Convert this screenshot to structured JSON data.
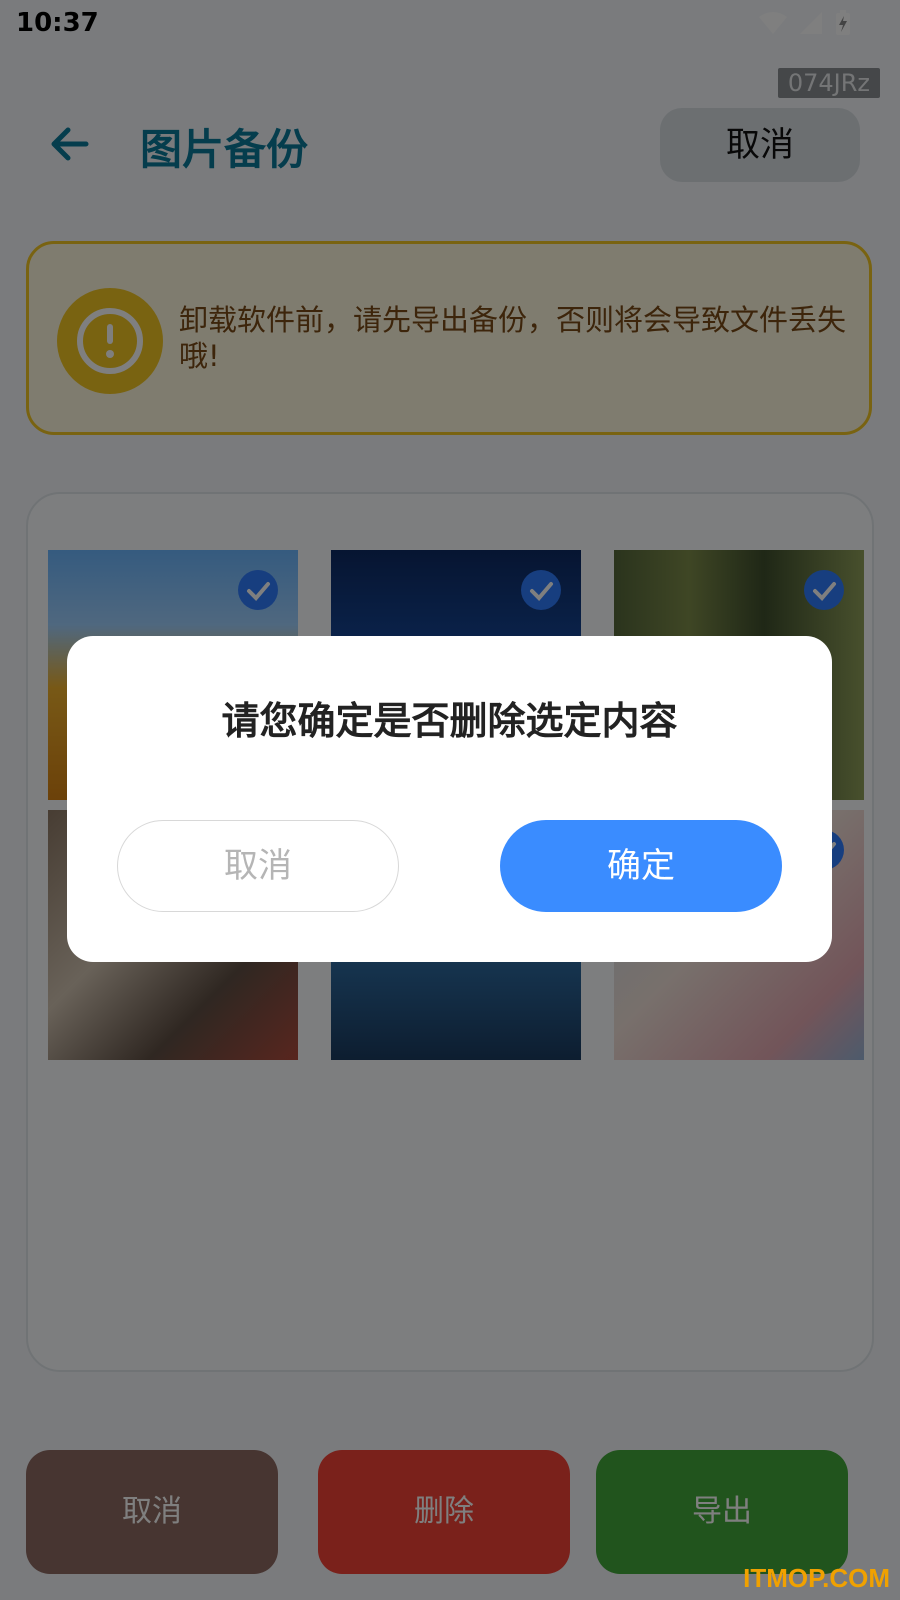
{
  "status_bar": {
    "time": "10:37",
    "icons": [
      "wifi-icon",
      "signal-icon",
      "battery-charging-icon"
    ]
  },
  "tag": "074JRz",
  "header": {
    "title": "图片备份",
    "cancel_label": "取消"
  },
  "warning": {
    "icon": "exclamation-circle-icon",
    "text": "卸载软件前，请先导出备份，否则将会导致文件丢失哦!"
  },
  "photos": [
    {
      "name": "sunflower-photo",
      "selected": true
    },
    {
      "name": "rain-umbrella-photo",
      "selected": true
    },
    {
      "name": "forest-photo",
      "selected": true
    },
    {
      "name": "newspaper-room-photo",
      "selected": true
    },
    {
      "name": "water-outfit-photo",
      "selected": true
    },
    {
      "name": "girl-flowers-photo",
      "selected": true
    }
  ],
  "bottom_actions": {
    "cancel": "取消",
    "delete": "删除",
    "export": "导出"
  },
  "colors": {
    "cancel": "#8f6a63",
    "delete": "#f44336",
    "export": "#43a83b",
    "accent": "#3a8cff"
  },
  "dialog": {
    "title": "请您确定是否删除选定内容",
    "cancel": "取消",
    "confirm": "确定"
  },
  "watermark": "ITMOP.COM"
}
